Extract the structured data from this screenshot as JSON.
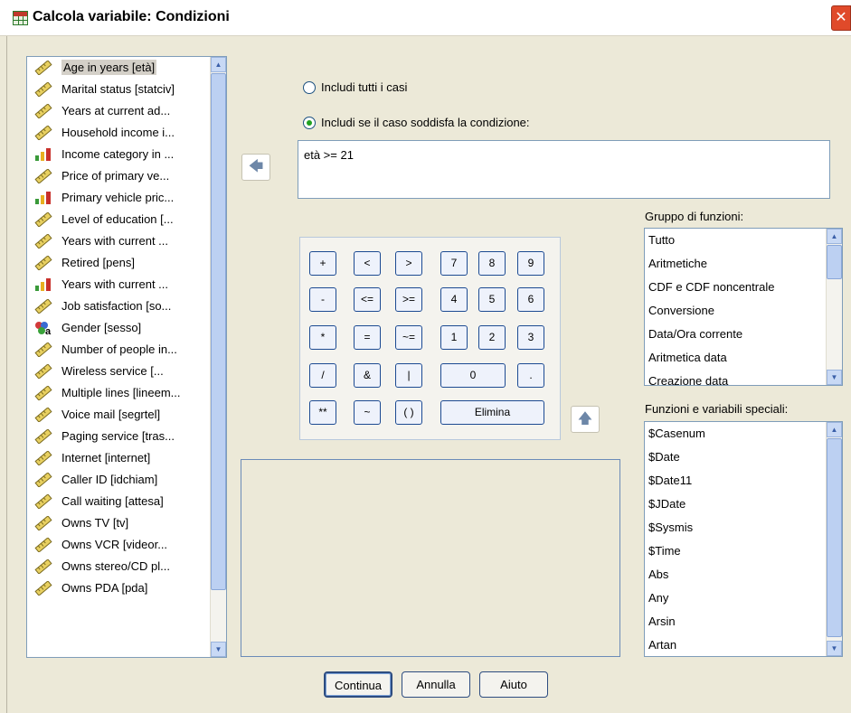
{
  "window": {
    "title": "Calcola variabile: Condizioni",
    "close_glyph": "✕"
  },
  "variables": [
    {
      "label": "Age in years [età]",
      "icon": "scale-icon"
    },
    {
      "label": "Marital status [statciv]",
      "icon": "scale-icon"
    },
    {
      "label": "Years at current ad...",
      "icon": "scale-icon"
    },
    {
      "label": "Household income i...",
      "icon": "scale-icon"
    },
    {
      "label": "Income category in ...",
      "icon": "ordinal-icon"
    },
    {
      "label": "Price of primary ve...",
      "icon": "scale-icon"
    },
    {
      "label": "Primary vehicle pric...",
      "icon": "ordinal-icon"
    },
    {
      "label": "Level of education [...",
      "icon": "scale-icon"
    },
    {
      "label": "Years with current ...",
      "icon": "scale-icon"
    },
    {
      "label": "Retired [pens]",
      "icon": "scale-icon"
    },
    {
      "label": "Years with current ...",
      "icon": "ordinal-icon"
    },
    {
      "label": "Job satisfaction [so...",
      "icon": "scale-icon"
    },
    {
      "label": "Gender [sesso]",
      "icon": "nominal-string-icon"
    },
    {
      "label": "Number of people in...",
      "icon": "scale-icon"
    },
    {
      "label": "Wireless service [...",
      "icon": "scale-icon"
    },
    {
      "label": "Multiple lines [lineem...",
      "icon": "scale-icon"
    },
    {
      "label": "Voice mail [segrtel]",
      "icon": "scale-icon"
    },
    {
      "label": "Paging service [tras...",
      "icon": "scale-icon"
    },
    {
      "label": "Internet [internet]",
      "icon": "scale-icon"
    },
    {
      "label": "Caller ID [idchiam]",
      "icon": "scale-icon"
    },
    {
      "label": "Call waiting [attesa]",
      "icon": "scale-icon"
    },
    {
      "label": "Owns TV [tv]",
      "icon": "scale-icon"
    },
    {
      "label": "Owns VCR [videor...",
      "icon": "scale-icon"
    },
    {
      "label": "Owns stereo/CD pl...",
      "icon": "scale-icon"
    },
    {
      "label": "Owns PDA [pda]",
      "icon": "scale-icon"
    }
  ],
  "options": {
    "include_all": "Includi tutti i casi",
    "include_if": "Includi se il caso soddisfa la condizione:",
    "selected": "include_if"
  },
  "expression": "età >= 21",
  "keypad": {
    "plus": "+",
    "lt": "<",
    "gt": ">",
    "k7": "7",
    "k8": "8",
    "k9": "9",
    "minus": "-",
    "le": "<=",
    "ge": ">=",
    "k4": "4",
    "k5": "5",
    "k6": "6",
    "mul": "*",
    "eq": "=",
    "ne": "~=",
    "k1": "1",
    "k2": "2",
    "k3": "3",
    "div": "/",
    "and": "&",
    "or": "|",
    "k0": "0",
    "dot": ".",
    "pow": "**",
    "not": "~",
    "paren": "( )",
    "delete": "Elimina"
  },
  "function_groups": {
    "label": "Gruppo di funzioni:",
    "items": [
      "Tutto",
      "Aritmetiche",
      "CDF e CDF noncentrale",
      "Conversione",
      "Data/Ora corrente",
      "Aritmetica data",
      "Creazione data"
    ]
  },
  "functions": {
    "label": "Funzioni e variabili speciali:",
    "items": [
      "$Casenum",
      "$Date",
      "$Date11",
      "$JDate",
      "$Sysmis",
      "$Time",
      "Abs",
      "Any",
      "Arsin",
      "Artan"
    ]
  },
  "buttons": {
    "continue": "Continua",
    "cancel": "Annulla",
    "help": "Aiuto"
  }
}
